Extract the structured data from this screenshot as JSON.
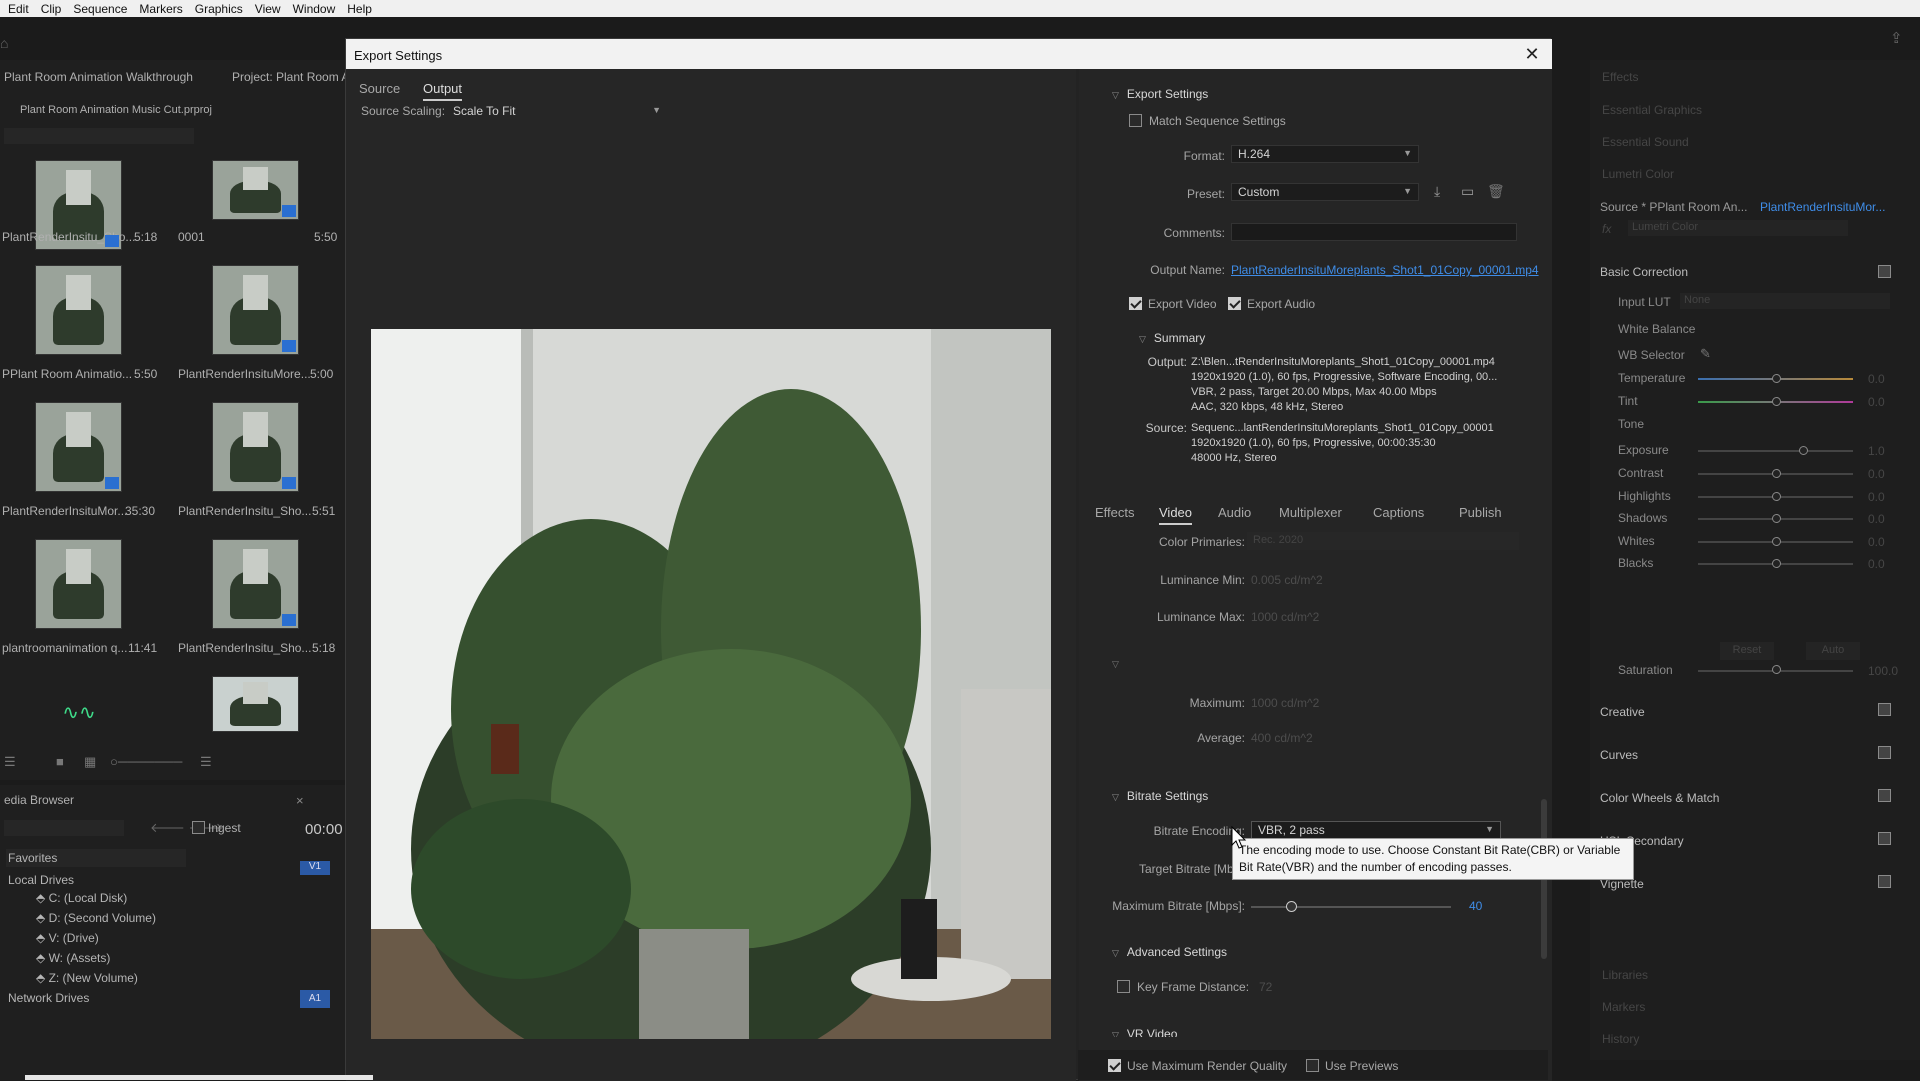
{
  "menubar": {
    "items": [
      "Edit",
      "Clip",
      "Sequence",
      "Markers",
      "Graphics",
      "View",
      "Window",
      "Help"
    ]
  },
  "project": {
    "tabs": [
      "Plant Room Animation Walkthrough",
      "Project: Plant Room An"
    ],
    "file": "Plant Room Animation Music Cut.prproj",
    "items": [
      {
        "name": "PlantRenderInsitu_Sho...",
        "duration": "5:18"
      },
      {
        "name": "0001",
        "duration": "5:50"
      },
      {
        "name": "PPlant Room Animatio...",
        "duration": "5:50"
      },
      {
        "name": "PlantRenderInsituMore...",
        "duration": "5:00"
      },
      {
        "name": "PlantRenderInsituMor...",
        "duration": "35:30"
      },
      {
        "name": "PlantRenderInsitu_Sho...",
        "duration": "5:51"
      },
      {
        "name": "plantroomanimation q...",
        "duration": "11:41"
      },
      {
        "name": "PlantRenderInsitu_Sho...",
        "duration": "5:18"
      }
    ]
  },
  "media_browser": {
    "title": "edia Browser",
    "ingest": "Ingest",
    "timecode": "00:00",
    "favorites": "Favorites",
    "local_drives": "Local Drives",
    "drives": [
      "C: (Local Disk)",
      "D: (Second Volume)",
      "V: (Drive)",
      "W: (Assets)",
      "Z: (New Volume)"
    ],
    "network": "Network Drives",
    "track_v1": "V1",
    "track_a1": "A1"
  },
  "lumetri": {
    "panels": [
      "Effects",
      "Essential Graphics",
      "Essential Sound",
      "Lumetri Color"
    ],
    "source": "Source * PPlant Room An...",
    "clip": "PlantRenderInsituMor...",
    "fx": "fx",
    "effect": "Lumetri Color",
    "basic": "Basic Correction",
    "input_lut": "Input LUT",
    "input_lut_val": "None",
    "white_balance": "White Balance",
    "wb_selector": "WB Selector",
    "rows": [
      {
        "label": "Temperature",
        "value": "0.0",
        "pos": 0.5
      },
      {
        "label": "Tint",
        "value": "0.0",
        "pos": 0.5
      },
      {
        "label": "Exposure",
        "value": "1.0",
        "pos": 0.68
      },
      {
        "label": "Contrast",
        "value": "0.0",
        "pos": 0.5
      },
      {
        "label": "Highlights",
        "value": "0.0",
        "pos": 0.5
      },
      {
        "label": "Shadows",
        "value": "0.0",
        "pos": 0.5
      },
      {
        "label": "Whites",
        "value": "0.0",
        "pos": 0.5
      },
      {
        "label": "Blacks",
        "value": "0.0",
        "pos": 0.5
      }
    ],
    "tone": "Tone",
    "reset": "Reset",
    "auto": "Auto",
    "saturation": {
      "label": "Saturation",
      "value": "100.0",
      "pos": 0.5
    },
    "sections": [
      "Creative",
      "Curves",
      "Color Wheels & Match",
      "HSL Secondary",
      "Vignette"
    ],
    "bottom": [
      "Libraries",
      "Markers",
      "History"
    ]
  },
  "dialog": {
    "title": "Export Settings",
    "tabs": {
      "source": "Source",
      "output": "Output"
    },
    "source_scaling_label": "Source Scaling:",
    "source_scaling": "Scale To Fit",
    "export_settings": "Export Settings",
    "match_sequence": "Match Sequence Settings",
    "format_label": "Format:",
    "format": "H.264",
    "preset_label": "Preset:",
    "preset": "Custom",
    "comments_label": "Comments:",
    "output_name_label": "Output Name:",
    "output_name": "PlantRenderInsituMoreplants_Shot1_01Copy_00001.mp4",
    "export_video": "Export Video",
    "export_audio": "Export Audio",
    "summary": "Summary",
    "output_label": "Output:",
    "output_lines": [
      "Z:\\Blen...tRenderInsituMoreplants_Shot1_01Copy_00001.mp4",
      "1920x1920 (1.0), 60 fps, Progressive, Software Encoding, 00...",
      "VBR, 2 pass, Target 20.00 Mbps, Max 40.00 Mbps",
      "AAC, 320 kbps, 48 kHz, Stereo"
    ],
    "source_label": "Source:",
    "source_lines": [
      "Sequenc...lantRenderInsituMoreplants_Shot1_01Copy_00001",
      "1920x1920 (1.0), 60 fps, Progressive, 00:00:35:30",
      "48000 Hz, Stereo"
    ],
    "settings_tabs": [
      "Effects",
      "Video",
      "Audio",
      "Multiplexer",
      "Captions",
      "Publish"
    ],
    "color_primaries_label": "Color Primaries:",
    "color_primaries": "Rec. 2020",
    "lum_min_label": "Luminance Min:",
    "lum_min": "0.005 cd/m^2",
    "lum_max_label": "Luminance Max:",
    "lum_max": "1000 cd/m^2",
    "maximum_label": "Maximum:",
    "maximum": "1000 cd/m^2",
    "average_label": "Average:",
    "average": "400 cd/m^2",
    "bitrate_settings": "Bitrate Settings",
    "bitrate_encoding_label": "Bitrate Encoding:",
    "bitrate_encoding": "VBR, 2 pass",
    "target_bitrate_label": "Target Bitrate [Mbps]:",
    "max_bitrate_label": "Maximum Bitrate [Mbps]:",
    "max_bitrate": "40",
    "max_bitrate_pos": 0.2,
    "advanced_settings": "Advanced Settings",
    "key_frame": "Key Frame Distance:",
    "key_frame_val": "72",
    "vr_video": "VR Video",
    "use_max_render": "Use Maximum Render Quality",
    "use_previews": "Use Previews",
    "tooltip": "The encoding mode to use. Choose Constant Bit Rate(CBR) or Variable Bit Rate(VBR) and the number of encoding passes."
  }
}
